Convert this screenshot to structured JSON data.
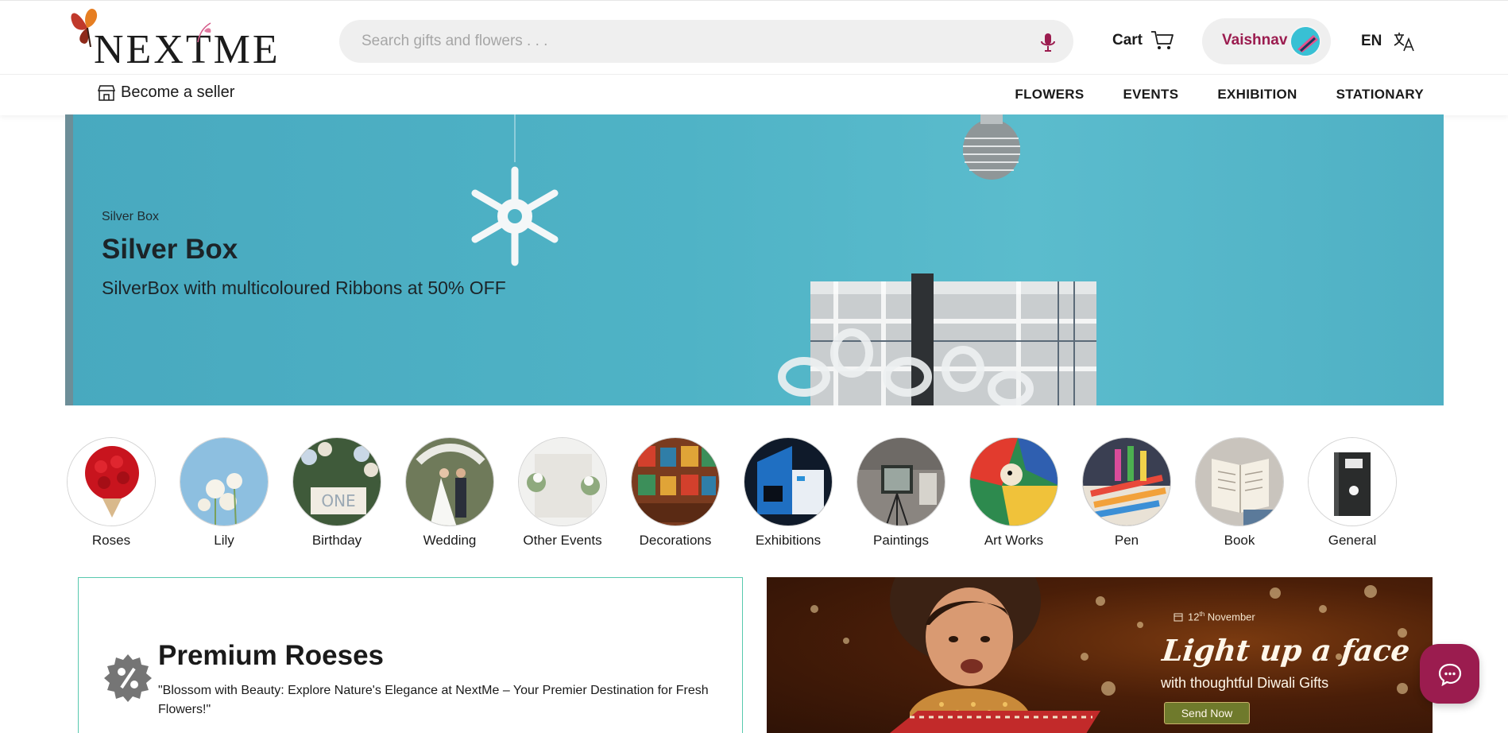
{
  "brand": {
    "name": "NEXTME"
  },
  "search": {
    "placeholder": "Search gifts and flowers . . ."
  },
  "cart": {
    "label": "Cart"
  },
  "user": {
    "name": "Vaishnav"
  },
  "language": {
    "code": "EN"
  },
  "seller": {
    "label": "Become a seller"
  },
  "nav": {
    "items": [
      "FLOWERS",
      "EVENTS",
      "EXHIBITION",
      "STATIONARY"
    ]
  },
  "hero": {
    "eyebrow": "Silver Box",
    "title": "Silver Box",
    "subtitle": "SilverBox with multicoloured Ribbons at 50% OFF"
  },
  "categories": [
    {
      "label": "Roses"
    },
    {
      "label": "Lily"
    },
    {
      "label": "Birthday"
    },
    {
      "label": "Wedding"
    },
    {
      "label": "Other Events"
    },
    {
      "label": "Decorations"
    },
    {
      "label": "Exhibitions"
    },
    {
      "label": "Paintings"
    },
    {
      "label": "Art Works"
    },
    {
      "label": "Pen"
    },
    {
      "label": "Book"
    },
    {
      "label": "General"
    }
  ],
  "promo": {
    "title": "Premium Roeses",
    "text": "\"Blossom with Beauty: Explore Nature's Elegance at NextMe – Your Premier Destination for Fresh Flowers!\""
  },
  "diwali": {
    "date_day": "12",
    "date_suffix": "th",
    "date_month": "November",
    "headline": "Light up a face",
    "subline": "with thoughtful Diwali Gifts",
    "button": "Send Now"
  },
  "colors": {
    "brand_accent": "#9b1c4f",
    "promo_border": "#58c9ae",
    "hero_bg": "#4fb3c6"
  },
  "icons": {
    "mic": "microphone-icon",
    "cart": "cart-icon",
    "language": "translate-icon",
    "seller": "store-icon",
    "chat": "chat-icon",
    "promo": "discount-badge-icon"
  }
}
